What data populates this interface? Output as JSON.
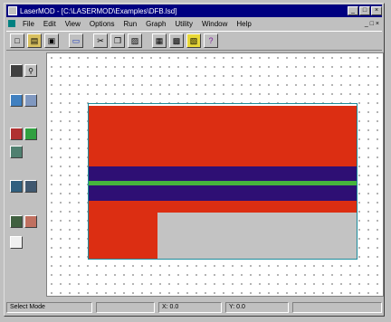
{
  "window": {
    "title": "LaserMOD - [C:\\LASERMOD\\Examples\\DFB.lsd]",
    "caption_buttons": [
      "_",
      "□",
      "×"
    ]
  },
  "menu": {
    "items": [
      "File",
      "Edit",
      "View",
      "Options",
      "Run",
      "Graph",
      "Utility",
      "Window",
      "Help"
    ],
    "right": "_ □ ×"
  },
  "toolbar": {
    "buttons": [
      {
        "icon": "new-icon",
        "glyph": "□"
      },
      {
        "icon": "open-icon",
        "glyph": "▤"
      },
      {
        "icon": "save-icon",
        "glyph": "▣"
      },
      {
        "icon": "print-icon",
        "glyph": "▭"
      },
      {
        "icon": "cut-icon",
        "glyph": "✂"
      },
      {
        "icon": "copy-icon",
        "glyph": "❐"
      },
      {
        "icon": "paste-icon",
        "glyph": "▨"
      },
      {
        "icon": "properties-icon",
        "glyph": "▦"
      },
      {
        "icon": "run-icon",
        "glyph": "▩"
      },
      {
        "icon": "graph-icon",
        "glyph": "▧"
      },
      {
        "icon": "help-icon",
        "glyph": "?"
      }
    ]
  },
  "status": {
    "mode": "Select Mode",
    "x": "X: 0.0",
    "y": "Y: 0.0"
  },
  "colors": {
    "red": "#dc2e12",
    "navy": "#2e0f74",
    "green": "#46b43c",
    "gray": "#c3c3c3",
    "outline": "#1c8c9c"
  }
}
